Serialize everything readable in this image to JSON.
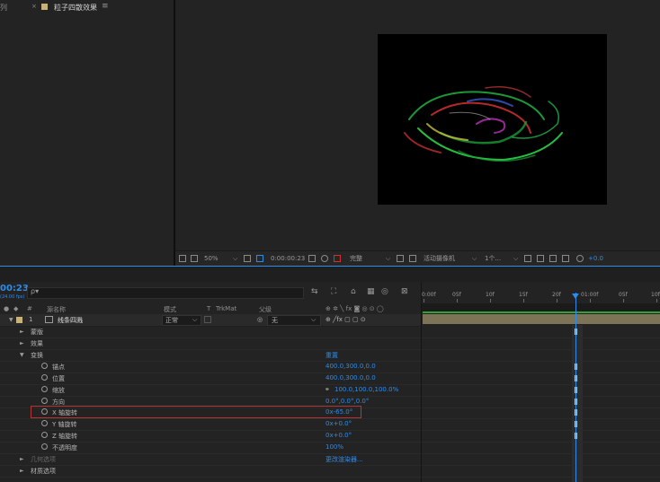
{
  "top": {
    "left_panel_title": "列",
    "viewer_toolbar": {
      "zoom": "50%",
      "timecode": "0:00:00:23",
      "resolution": "完整",
      "camera": "活动摄像机",
      "views": "1个...",
      "exposure": "+0.0"
    }
  },
  "timeline": {
    "tab_left_label": "列",
    "tab_close": "×",
    "tab_label": "粒子四散效果",
    "tab_menu": "≡",
    "timecode": "00:23",
    "timecode_sub": "(24.00 fps)",
    "search_placeholder": "ρ▾",
    "columns": {
      "num": "#",
      "source_name": "源名称",
      "mode": "模式",
      "t": "T",
      "trkmat": "TrkMat",
      "parent": "父级"
    },
    "layer": {
      "number": "1",
      "name": "线条四溅",
      "mode": "正常",
      "parent": "无"
    },
    "rows": [
      {
        "label": "蒙版",
        "value": ""
      },
      {
        "label": "效果",
        "value": ""
      },
      {
        "label": "变换",
        "value": "重置"
      },
      {
        "label": "锚点",
        "value": "400.0,300.0,0.0"
      },
      {
        "label": "位置",
        "value": "400.0,300.0,0.0"
      },
      {
        "label": "缩放",
        "value": "100.0,100.0,100.0%"
      },
      {
        "label": "方向",
        "value": "0.0°,0.0°,0.0°"
      },
      {
        "label": "X 轴旋转",
        "value": "0x-65.0°"
      },
      {
        "label": "Y 轴旋转",
        "value": "0x+0.0°"
      },
      {
        "label": "Z 轴旋转",
        "value": "0x+0.0°"
      },
      {
        "label": "不透明度",
        "value": "100%"
      },
      {
        "label": "几何选项",
        "value": "更改渲染器..."
      },
      {
        "label": "材质选项",
        "value": ""
      }
    ],
    "ruler_labels": [
      "0:00f",
      "05f",
      "10f",
      "15f",
      "20f",
      "01:00f",
      "05f",
      "10f"
    ]
  },
  "colors": {
    "accent": "#2d8ceb",
    "highlight": "#b33636",
    "layer_bar": "#7d7357"
  }
}
